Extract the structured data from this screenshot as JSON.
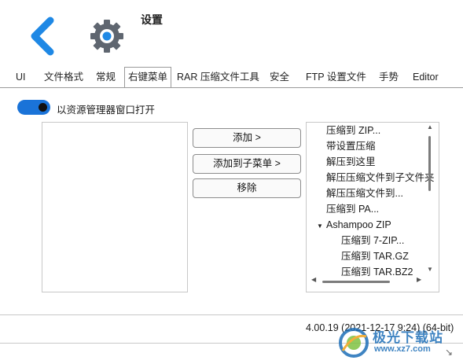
{
  "header": {
    "title": "设置"
  },
  "tabs": [
    {
      "label": "UI",
      "active": false
    },
    {
      "label": "文件格式",
      "active": false
    },
    {
      "label": "常规",
      "active": false
    },
    {
      "label": "右键菜单",
      "active": true
    },
    {
      "label": "RAR 压缩文件工具",
      "active": false
    },
    {
      "label": "安全",
      "active": false
    },
    {
      "label": "FTP 设置文件",
      "active": false
    },
    {
      "label": "手势",
      "active": false
    },
    {
      "label": "Editor",
      "active": false
    }
  ],
  "toggle": {
    "label": "以资源管理器窗口打开",
    "on": true
  },
  "buttons": {
    "add": "添加 >",
    "add_submenu": "添加到子菜单 >",
    "remove": "移除"
  },
  "menu_items": [
    {
      "label": "压缩到 ZIP...",
      "level": 0
    },
    {
      "label": "带设置压缩",
      "level": 0
    },
    {
      "label": "解压到这里",
      "level": 0
    },
    {
      "label": "解压压缩文件到子文件夹",
      "level": 0
    },
    {
      "label": "解压压缩文件到...",
      "level": 0
    },
    {
      "label": "压缩到 PA...",
      "level": 0
    },
    {
      "label": "Ashampoo ZIP",
      "level": 0,
      "expanded": true
    },
    {
      "label": "压缩到 7-ZIP...",
      "level": 1
    },
    {
      "label": "压缩到 TAR.GZ",
      "level": 1
    },
    {
      "label": "压缩到 TAR.BZ2",
      "level": 1
    }
  ],
  "status": {
    "version": "4.00.19 (2021-12-17 9:24) (64-bit)"
  },
  "watermark": {
    "name": "极光下载站",
    "url": "www.xz7.com"
  },
  "colors": {
    "accent": "#1a73d8",
    "back_arrow": "#1e88e5",
    "gear": "#5f6670"
  },
  "icons": {
    "back": "chevron-left-icon",
    "settings": "gear-icon"
  }
}
